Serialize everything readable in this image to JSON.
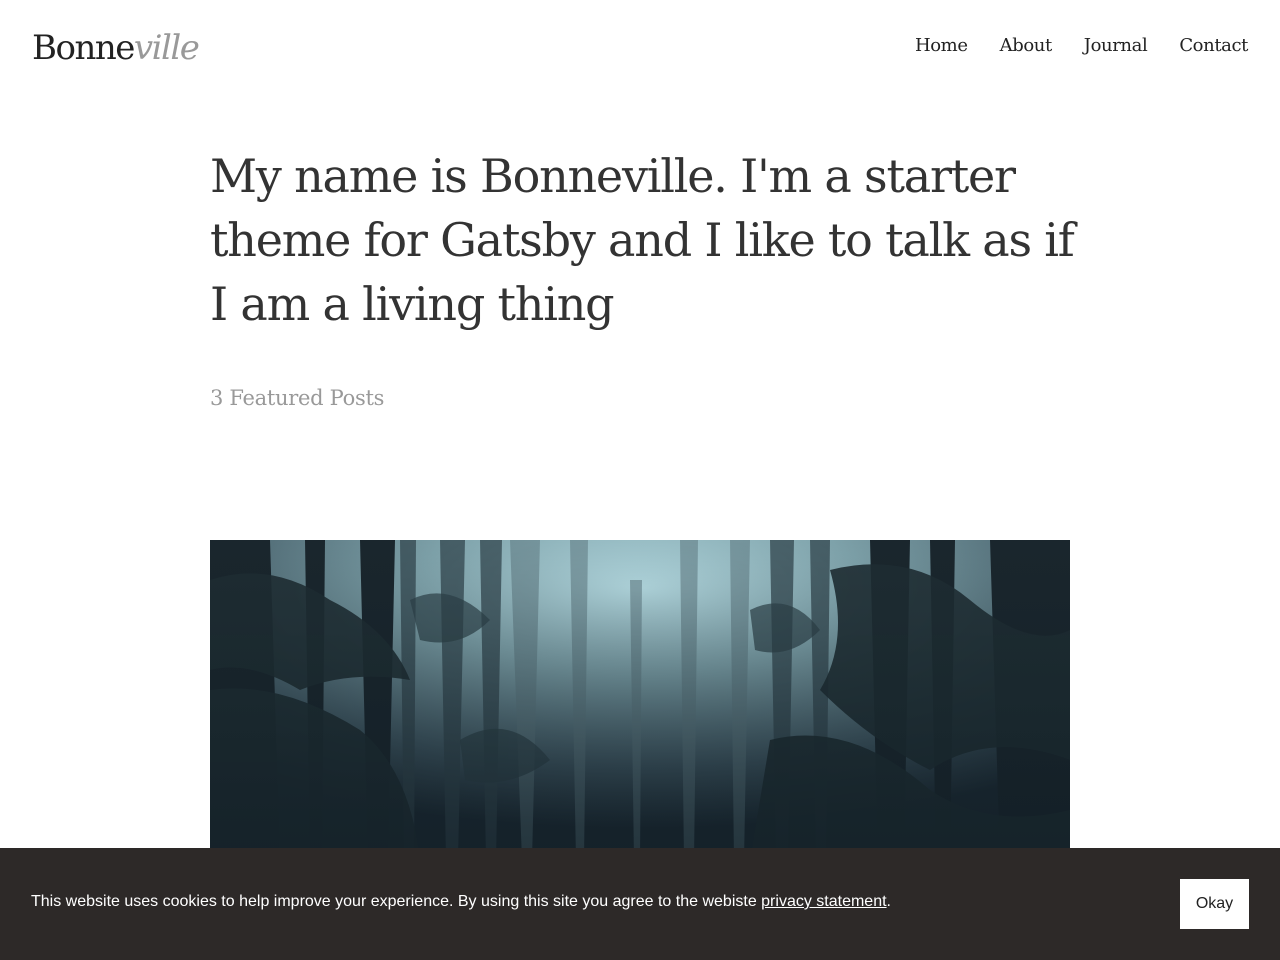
{
  "site": {
    "logo_regular": "Bonne",
    "logo_italic": "ville"
  },
  "nav": {
    "items": [
      {
        "label": "Home"
      },
      {
        "label": "About"
      },
      {
        "label": "Journal"
      },
      {
        "label": "Contact"
      }
    ]
  },
  "hero": {
    "headline": "My name is Bonneville. I'm a starter theme for Gatsby and I like to talk as if I am a living thing",
    "featured_count_label": "3 Featured Posts"
  },
  "cookie_banner": {
    "text_before_link": "This website uses cookies to help improve your experience. By using this site you agree to the webiste ",
    "link_text": "privacy statement",
    "text_after_link": ".",
    "button_label": "Okay"
  },
  "colors": {
    "text": "#333333",
    "muted": "#999999",
    "cookie_bar_bg": "#2d2928",
    "button_bg": "#ffffff"
  }
}
